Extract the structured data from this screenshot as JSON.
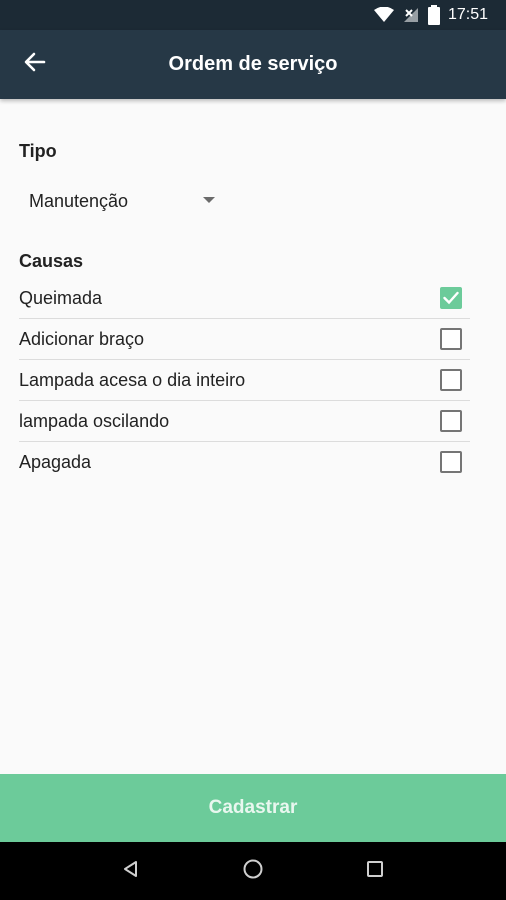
{
  "status_bar": {
    "time": "17:51",
    "icons": [
      "wifi-icon",
      "signal-off-icon",
      "battery-icon"
    ]
  },
  "app_bar": {
    "title": "Ordem de serviço",
    "back_icon": "arrow-left-icon"
  },
  "form": {
    "tipo_label": "Tipo",
    "tipo_value": "Manutenção",
    "causas_label": "Causas",
    "causas": [
      {
        "label": "Queimada",
        "checked": true
      },
      {
        "label": "Adicionar braço",
        "checked": false
      },
      {
        "label": "Lampada acesa o dia inteiro",
        "checked": false
      },
      {
        "label": "lampada oscilando",
        "checked": false
      },
      {
        "label": "Apagada",
        "checked": false
      }
    ],
    "submit_label": "Cadastrar"
  },
  "colors": {
    "status_bar": "#1c2a35",
    "app_bar": "#263846",
    "accent": "#6ccb9a"
  },
  "nav_bar": {
    "icons": [
      "back-triangle-icon",
      "home-circle-icon",
      "recents-square-icon"
    ]
  }
}
